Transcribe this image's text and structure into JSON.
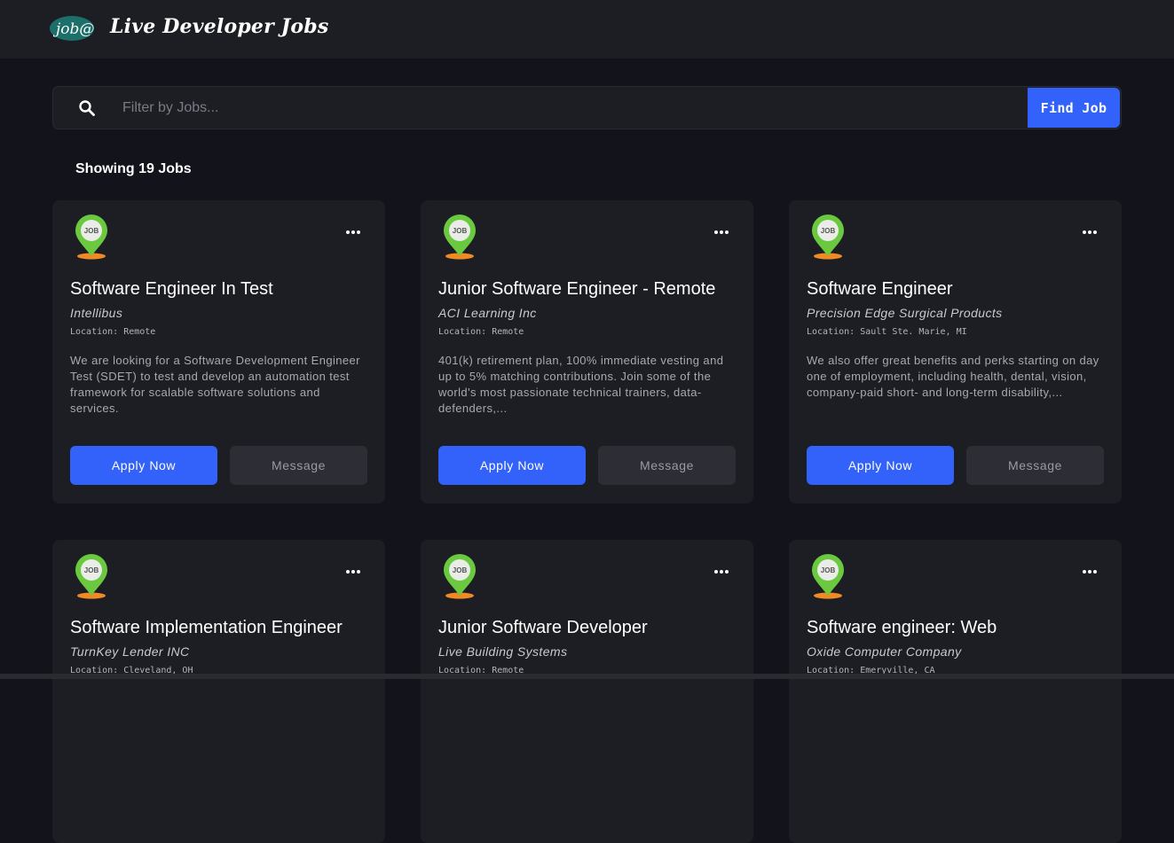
{
  "header": {
    "logo_text": "job@",
    "title": "Live Developer Jobs"
  },
  "search": {
    "placeholder": "Filter by Jobs...",
    "button_label": "Find Job"
  },
  "results": {
    "count_label": "Showing 19 Jobs"
  },
  "jobs": [
    {
      "title": "Software Engineer In Test",
      "company": "Intellibus",
      "location": "Location: Remote",
      "description": "We are looking for a Software Development Engineer Test (SDET) to test and develop an automation test framework for scalable software solutions and services.",
      "apply_label": "Apply Now",
      "message_label": "Message"
    },
    {
      "title": "Junior Software Engineer - Remote",
      "company": "ACI Learning Inc",
      "location": "Location: Remote",
      "description": "401(k) retirement plan, 100% immediate vesting and up to 5% matching contributions. Join some of the world's most passionate technical trainers, data-defenders,...",
      "apply_label": "Apply Now",
      "message_label": "Message"
    },
    {
      "title": "Software Engineer",
      "company": "Precision Edge Surgical Products",
      "location": "Location: Sault Ste. Marie, MI",
      "description": "We also offer great benefits and perks starting on day one of employment, including health, dental, vision, company-paid short- and long-term disability,...",
      "apply_label": "Apply Now",
      "message_label": "Message"
    },
    {
      "title": "Software Implementation Engineer",
      "company": "TurnKey Lender INC",
      "location": "Location: Cleveland, OH",
      "description": "",
      "apply_label": "",
      "message_label": ""
    },
    {
      "title": "Junior Software Developer",
      "company": "Live Building Systems",
      "location": "Location: Remote",
      "description": "",
      "apply_label": "",
      "message_label": ""
    },
    {
      "title": "Software engineer: Web",
      "company": "Oxide Computer Company",
      "location": "Location: Emeryville, CA",
      "description": "",
      "apply_label": "",
      "message_label": ""
    }
  ],
  "icons": {
    "pin_icon_text": "JOB"
  },
  "colors": {
    "background": "#13131b",
    "card": "#1d1d24",
    "accent": "#3262fa",
    "pin_green": "#6bc93f",
    "pin_base": "#f08a24"
  }
}
